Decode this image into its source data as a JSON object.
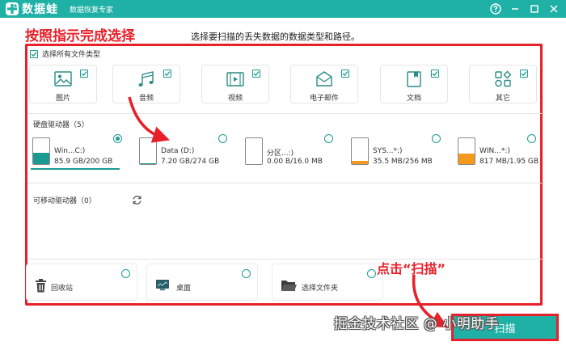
{
  "app": {
    "name": "数据蛙",
    "subtitle": "数据恢复专家",
    "accent": "#1fb0a6",
    "controls": [
      "help-icon",
      "minimize-icon",
      "restore-icon",
      "close-icon"
    ]
  },
  "annotation": {
    "title": "按照指示完成选择",
    "click_scan": "点击“扫描”",
    "watermark": "掘金技术社区 @ 小明助手",
    "color": "#e8202a"
  },
  "subtitle": "选择要扫描的丢失数据的数据类型和路径。",
  "select_all": {
    "label": "选择所有文件类型",
    "checked": true
  },
  "file_types": [
    {
      "label": "图片",
      "icon": "image-icon",
      "checked": true
    },
    {
      "label": "音频",
      "icon": "music-icon",
      "checked": true
    },
    {
      "label": "视频",
      "icon": "video-icon",
      "checked": true
    },
    {
      "label": "电子邮件",
      "icon": "email-icon",
      "checked": true
    },
    {
      "label": "文档",
      "icon": "document-icon",
      "checked": true
    },
    {
      "label": "其它",
      "icon": "other-icon",
      "checked": true
    }
  ],
  "hard_drives": {
    "label": "硬盘驱动器（5）",
    "items": [
      {
        "name": "Win...C:)",
        "size": "85.9 GB/200 GB",
        "used": 0.43,
        "selected": true,
        "fill_color": "#1a9b92"
      },
      {
        "name": "Data (D:)",
        "size": "7.20 GB/274 GB",
        "used": 0.03,
        "selected": false,
        "fill_color": "#1a9b92"
      },
      {
        "name": "分区...:)",
        "size": "0.00  B/16.0 MB",
        "used": 0.0,
        "selected": false,
        "fill_color": "#1a9b92"
      },
      {
        "name": "SYS...*:)",
        "size": "35.5 MB/256 MB",
        "used": 0.14,
        "selected": false,
        "fill_color": "#f39a1e"
      },
      {
        "name": "WIN...*:)",
        "size": "817 MB/1.95 GB",
        "used": 0.42,
        "selected": false,
        "fill_color": "#f39a1e"
      }
    ]
  },
  "removable": {
    "label": "可移动驱动器（0）",
    "refresh_icon": "refresh-icon"
  },
  "locations": [
    {
      "label": "回收站",
      "icon": "trash-icon"
    },
    {
      "label": "桌面",
      "icon": "desktop-icon"
    },
    {
      "label": "选择文件夹",
      "icon": "folder-icon"
    }
  ],
  "scan_button": {
    "label": "扫描"
  }
}
